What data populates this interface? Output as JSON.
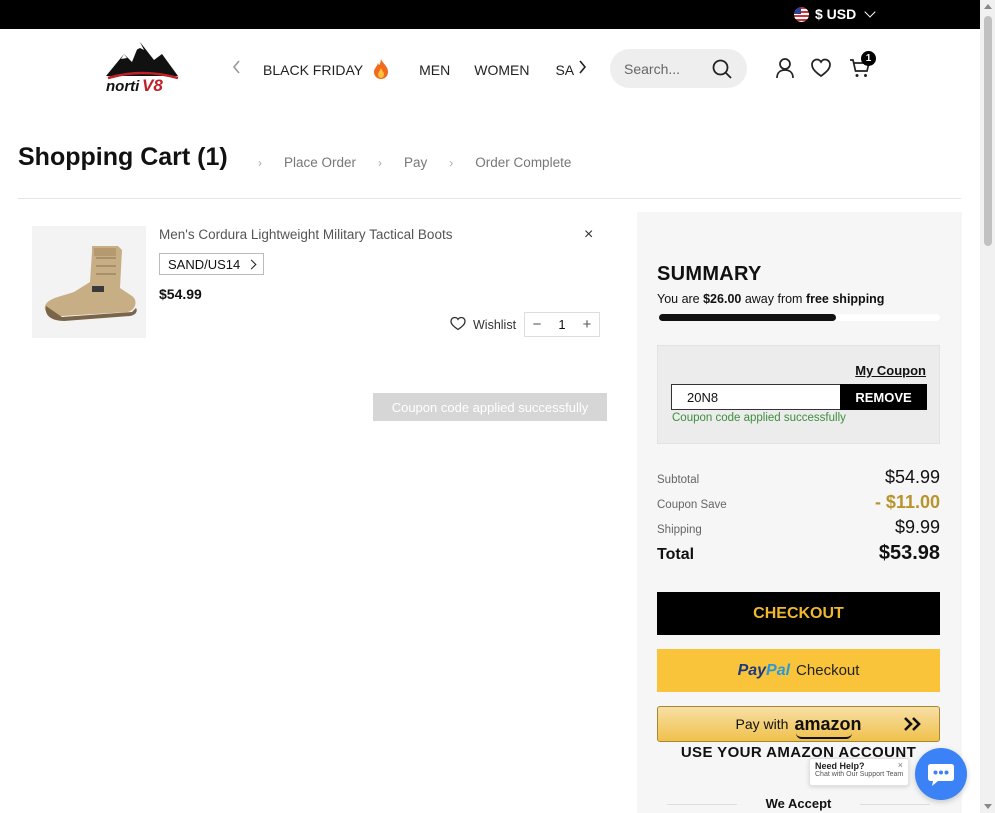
{
  "topbar": {
    "currency": "$ USD"
  },
  "header": {
    "logo_text": "nortiV8",
    "nav": [
      {
        "label": "BLACK FRIDAY"
      },
      {
        "label": "MEN"
      },
      {
        "label": "WOMEN"
      },
      {
        "label": "SALE"
      }
    ],
    "search_placeholder": "Search...",
    "cart_count": "1"
  },
  "breadcrumb": {
    "title": "Shopping Cart (1)",
    "steps": [
      "Place Order",
      "Pay",
      "Order Complete"
    ]
  },
  "cart": {
    "item": {
      "name": "Men's Cordura Lightweight Military Tactical Boots",
      "variant": "SAND/US14",
      "price": "$54.99",
      "quantity": "1",
      "wishlist_label": "Wishlist",
      "minus": "−",
      "plus": "+",
      "remove": "×"
    },
    "toast": "Coupon code applied successfully"
  },
  "summary": {
    "title": "SUMMARY",
    "shipping_msg_pre": "You are ",
    "shipping_amount": "$26.00",
    "shipping_msg_mid": " away from ",
    "shipping_msg_bold": "free shipping",
    "progress_percent": 63,
    "my_coupon": "My Coupon",
    "coupon_code": "20N8",
    "remove_label": "REMOVE",
    "coupon_status": "Coupon code applied successfully",
    "subtotal_label": "Subtotal",
    "subtotal": "$54.99",
    "coupon_save_label": "Coupon Save",
    "coupon_save": "- $11.00",
    "shipping_label": "Shipping",
    "shipping": "$9.99",
    "total_label": "Total",
    "total": "$53.98",
    "checkout_label": "CHECKOUT",
    "paypal_pay": "Pay",
    "paypal_pal": "Pal",
    "paypal_checkout": "Checkout",
    "amazon_pre": "Pay with",
    "amazon_brand": "amazon",
    "amazon_note": "USE YOUR AMAZON ACCOUNT",
    "we_accept": "We Accept"
  },
  "chat": {
    "title": "Need Help?",
    "subtitle": "Chat with Our Support Team",
    "close": "×"
  },
  "colors": {
    "accent_gold": "#f0b82e",
    "coupon_save": "#b8942d",
    "paypal_yellow": "#fac43a",
    "chat_blue": "#3b82f6",
    "success_green": "#3e8e3e"
  }
}
